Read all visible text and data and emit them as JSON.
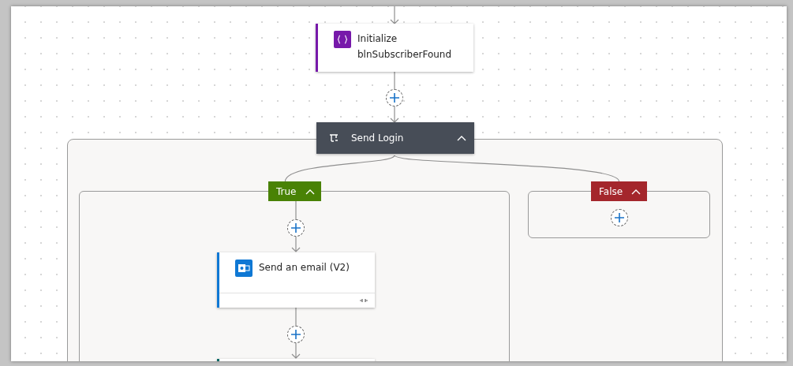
{
  "flow": {
    "steps": [
      {
        "kind": "action",
        "title": "Initialize",
        "subtitle": "blnSubscriberFound",
        "color": "#7719aa"
      },
      {
        "kind": "scope",
        "title": "Send Login",
        "expanded": true,
        "branches": [
          {
            "label": "True",
            "expanded": true,
            "color": "#498205",
            "steps": [
              {
                "kind": "action",
                "title": "Send an email (V2)",
                "color": "#0f78d4",
                "linked": true
              },
              {
                "kind": "action",
                "color": "#0b6a66"
              }
            ]
          },
          {
            "label": "False",
            "expanded": true,
            "color": "#a4262c"
          }
        ]
      }
    ]
  }
}
